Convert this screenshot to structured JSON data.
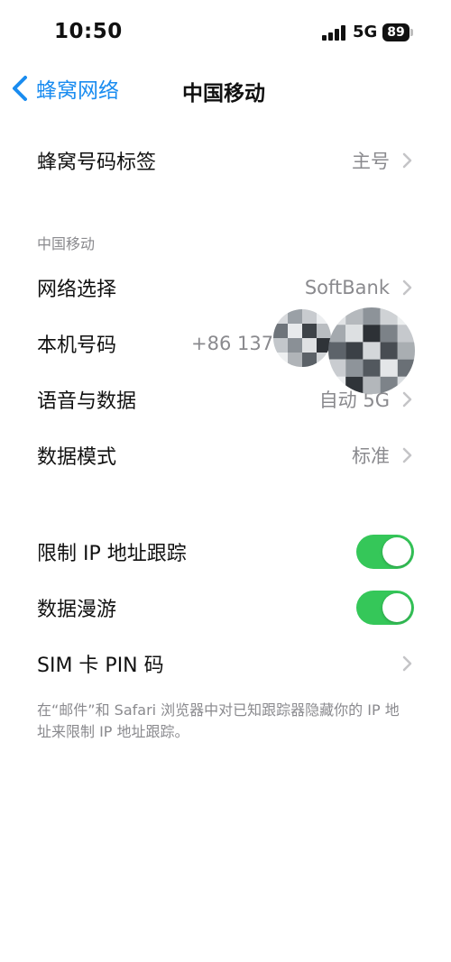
{
  "status_bar": {
    "time": "10:50",
    "network": "5G",
    "battery": "89"
  },
  "nav": {
    "back_label": "蜂窝网络",
    "title": "中国移动"
  },
  "top_row": {
    "label": "蜂窝号码标签",
    "value": "主号"
  },
  "section_header": "中国移动",
  "carrier_rows": [
    {
      "label": "网络选择",
      "value": "SoftBank"
    },
    {
      "label": "本机号码",
      "value": "+86 137"
    },
    {
      "label": "语音与数据",
      "value": "自动 5G"
    },
    {
      "label": "数据模式",
      "value": "标准"
    }
  ],
  "toggle_rows": [
    {
      "label": "限制 IP 地址跟踪",
      "on": true
    },
    {
      "label": "数据漫游",
      "on": true
    }
  ],
  "sim_pin_label": "SIM 卡 PIN 码",
  "footer": "在“邮件”和 Safari 浏览器中对已知跟踪器隐藏你的 IP 地址来限制 IP 地址跟踪。",
  "colors": {
    "accent": "#1a8cf0",
    "toggle_on": "#35c759",
    "secondary_text": "#8a8a8e"
  }
}
